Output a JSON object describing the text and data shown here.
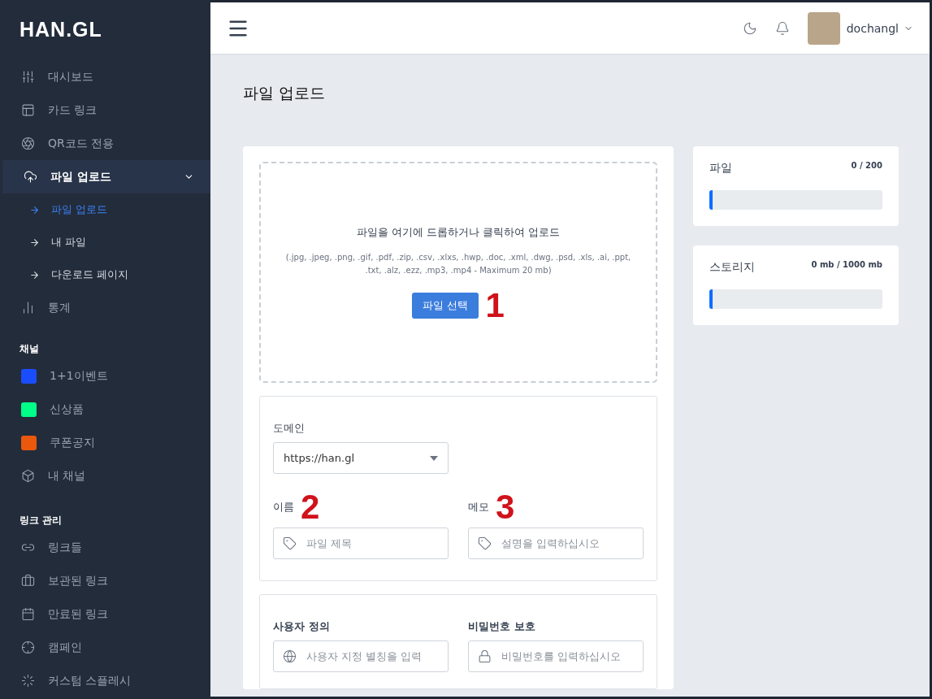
{
  "logo": "HAN.GL",
  "sidebar": {
    "menu": [
      {
        "label": "대시보드",
        "selected": false
      },
      {
        "label": "카드 링크",
        "selected": false
      },
      {
        "label": "QR코드 전용",
        "selected": false
      },
      {
        "label": "파일 업로드",
        "selected": true,
        "expanded": true,
        "children": [
          {
            "label": "파일 업로드",
            "selected": true
          },
          {
            "label": "내 파일",
            "selected": false
          },
          {
            "label": "다운로드 페이지",
            "selected": false
          }
        ]
      },
      {
        "label": "통계",
        "selected": false
      }
    ],
    "sections": [
      {
        "title": "채널",
        "items": [
          {
            "kind": "channel",
            "label": "1+1이벤트",
            "color": "#1a4dff"
          },
          {
            "kind": "channel",
            "label": "신상품",
            "color": "#00ff88"
          },
          {
            "kind": "channel",
            "label": "쿠폰공지",
            "color": "#ea580c"
          },
          {
            "kind": "link",
            "label": "내 채널"
          }
        ]
      },
      {
        "title": "링크 관리",
        "items": [
          {
            "kind": "link",
            "label": "링크들"
          },
          {
            "kind": "link",
            "label": "보관된 링크"
          },
          {
            "kind": "link",
            "label": "만료된 링크"
          },
          {
            "kind": "link",
            "label": "캠페인"
          },
          {
            "kind": "link",
            "label": "커스텀 스플레시"
          }
        ]
      }
    ]
  },
  "header": {
    "user": "dochangl"
  },
  "page_title": "파일 업로드",
  "dropzone": {
    "title": "파일을 여기에 드롭하거나 클릭하여 업로드",
    "formats": "(.jpg, .jpeg, .png, .gif, .pdf, .zip, .csv, .xlxs, .hwp, .doc, .xml, .dwg, .psd, .xls, .ai, .ppt, .txt, .alz, .ezz, .mp3, .mp4 - Maximum 20 mb)",
    "button": "파일 선택",
    "annotation": "1"
  },
  "domain": {
    "label": "도메인",
    "value": "https://han.gl"
  },
  "fields": [
    {
      "label": "이름",
      "placeholder": "파일 제목",
      "annotation": "2"
    },
    {
      "label": "메모",
      "placeholder": "설명을 입력하십시오",
      "annotation": "3"
    }
  ],
  "extra_fields": [
    {
      "label": "사용자 정의",
      "placeholder": "사용자 지정 별칭을 입력"
    },
    {
      "label": "비밀번호 보호",
      "placeholder": "비밀번호를 입력하십시오"
    }
  ],
  "stats": [
    {
      "label": "파일",
      "reading": "0 / 200",
      "level": 0.02
    },
    {
      "label": "스토리지",
      "reading": "0 mb / 1000 mb",
      "level": 0.02
    }
  ]
}
